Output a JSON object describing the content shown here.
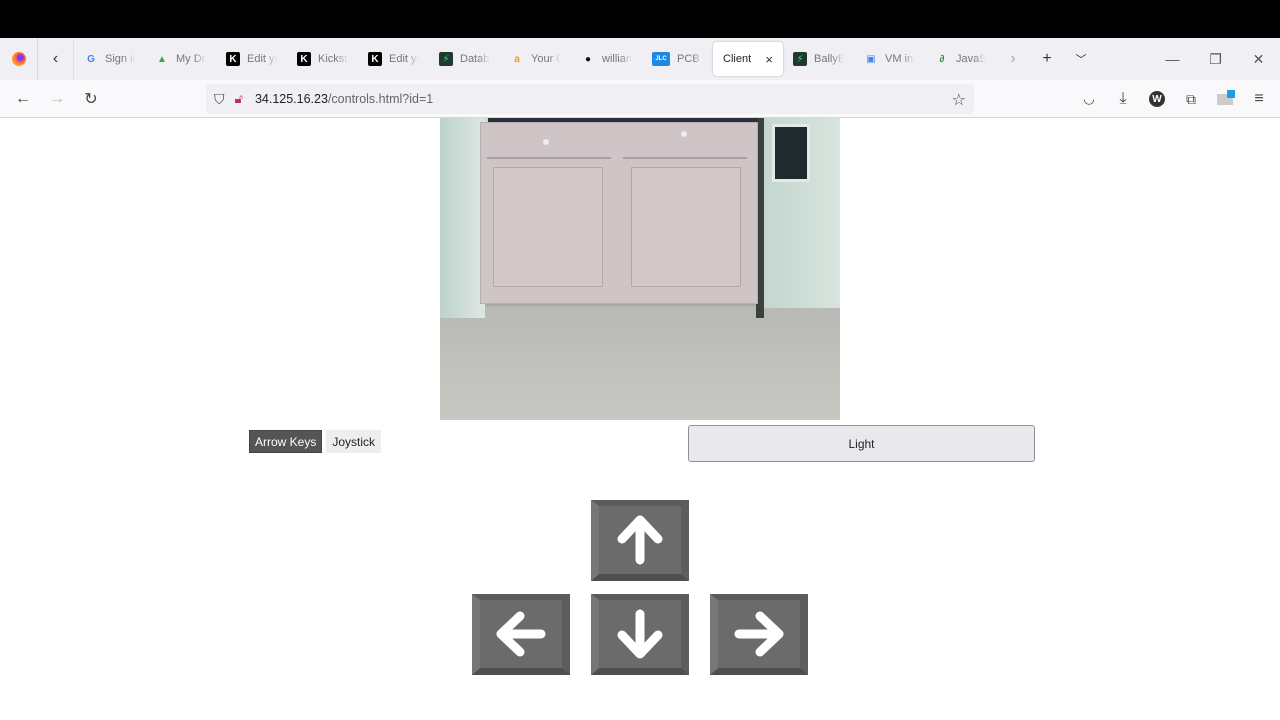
{
  "browser": {
    "tabs": [
      {
        "title": "Sign in",
        "icon": "google-icon",
        "color": "#4285f4"
      },
      {
        "title": "My Drive",
        "icon": "google-drive-icon",
        "color": "#34a853"
      },
      {
        "title": "Edit your",
        "icon": "kickstarter-icon",
        "color": "#000000"
      },
      {
        "title": "Kickstarter",
        "icon": "kickstarter-icon",
        "color": "#000000"
      },
      {
        "title": "Edit your",
        "icon": "kickstarter-icon",
        "color": "#000000"
      },
      {
        "title": "Database",
        "icon": "bolt-icon",
        "color": "#1f3a2f"
      },
      {
        "title": "Your Orders",
        "icon": "amazon-icon",
        "color": "#ff9900"
      },
      {
        "title": "william",
        "icon": "github-icon",
        "color": "#111111"
      },
      {
        "title": "PCB Prototype",
        "icon": "jlc-icon",
        "color": "#1e88e5"
      },
      {
        "title": "Client",
        "icon": "none",
        "active": true
      },
      {
        "title": "BallyB",
        "icon": "bolt-icon",
        "color": "#1f3a2f"
      },
      {
        "title": "VM instances",
        "icon": "chip-icon",
        "color": "#4285f4"
      },
      {
        "title": "JavaScript",
        "icon": "geeksforgeeks-icon",
        "color": "#2f8d46"
      }
    ],
    "active_tab_close": "×",
    "url_host": "34.125.16.23",
    "url_path": "/controls.html?id=1"
  },
  "controls": {
    "mode_tabs": [
      {
        "label": "Arrow Keys",
        "active": true
      },
      {
        "label": "Joystick",
        "active": false
      }
    ],
    "light_label": "Light",
    "keys": [
      "up",
      "left",
      "down",
      "right"
    ]
  },
  "camera": {
    "description": "Live camera feed showing kitchen cabinets and tiled floor"
  }
}
